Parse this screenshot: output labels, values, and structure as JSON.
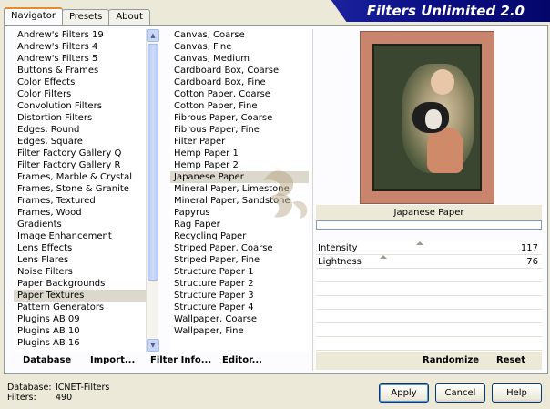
{
  "app": {
    "title": "Filters Unlimited 2.0"
  },
  "tabs": [
    {
      "label": "Navigator",
      "active": true
    },
    {
      "label": "Presets",
      "active": false
    },
    {
      "label": "About",
      "active": false
    }
  ],
  "categories": {
    "selected_index": 23,
    "items": [
      "Andrew's Filters 19",
      "Andrew's Filters 4",
      "Andrew's Filters 5",
      "Buttons & Frames",
      "Color Effects",
      "Color Filters",
      "Convolution Filters",
      "Distortion Filters",
      "Edges, Round",
      "Edges, Square",
      "Filter Factory Gallery Q",
      "Filter Factory Gallery R",
      "Frames, Marble & Crystal",
      "Frames, Stone & Granite",
      "Frames, Textured",
      "Frames, Wood",
      "Gradients",
      "Image Enhancement",
      "Lens Effects",
      "Lens Flares",
      "Noise Filters",
      "Paper Backgrounds",
      "Paper Textures",
      "Pattern Generators",
      "Plugins AB 09",
      "Plugins AB 10",
      "Plugins AB 16"
    ]
  },
  "filters": {
    "selected_index": 12,
    "items": [
      "Canvas, Coarse",
      "Canvas, Fine",
      "Canvas, Medium",
      "Cardboard Box, Coarse",
      "Cardboard Box, Fine",
      "Cotton Paper, Coarse",
      "Cotton Paper, Fine",
      "Fibrous Paper, Coarse",
      "Fibrous Paper, Fine",
      "Filter Paper",
      "Hemp Paper 1",
      "Hemp Paper 2",
      "Japanese Paper",
      "Mineral Paper, Limestone",
      "Mineral Paper, Sandstone",
      "Papyrus",
      "Rag Paper",
      "Recycling Paper",
      "Striped Paper, Coarse",
      "Striped Paper, Fine",
      "Structure Paper 1",
      "Structure Paper 2",
      "Structure Paper 3",
      "Structure Paper 4",
      "Wallpaper, Coarse",
      "Wallpaper, Fine"
    ]
  },
  "preview": {
    "filter_name": "Japanese Paper"
  },
  "sliders": [
    {
      "label": "Intensity",
      "value": "117",
      "fraction": 0.459
    },
    {
      "label": "Lightness",
      "value": "76",
      "fraction": 0.298
    }
  ],
  "buttons": {
    "database": "Database",
    "import": "Import...",
    "filter_info": "Filter Info...",
    "editor": "Editor...",
    "randomize": "Randomize",
    "reset": "Reset",
    "apply": "Apply",
    "cancel": "Cancel",
    "help": "Help"
  },
  "status": {
    "database_label": "Database:",
    "database_value": "ICNET-Filters",
    "filters_label": "Filters:",
    "filters_value": "490"
  }
}
